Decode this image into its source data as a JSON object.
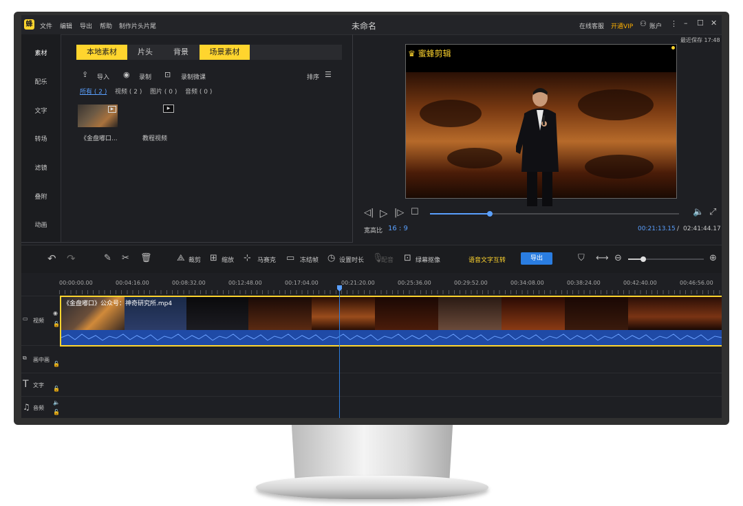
{
  "window": {
    "title": "未命名",
    "menu": [
      "文件",
      "编辑",
      "导出",
      "帮助",
      "制作片头片尾"
    ],
    "right": {
      "support": "在线客服",
      "vip": "开通VIP",
      "account": "账户"
    },
    "last_saved": "最近保存 17:48"
  },
  "sidebar": {
    "items": [
      {
        "label": "素材"
      },
      {
        "label": "配乐"
      },
      {
        "label": "文字"
      },
      {
        "label": "转场"
      },
      {
        "label": "滤镜"
      },
      {
        "label": "叠附"
      },
      {
        "label": "动画"
      }
    ]
  },
  "media": {
    "tabs": [
      {
        "label": "本地素材",
        "active": true
      },
      {
        "label": "片头",
        "active": false
      },
      {
        "label": "背景",
        "active": false
      },
      {
        "label": "场景素材",
        "active": true
      }
    ],
    "toolbar": {
      "import": "导入",
      "record": "录制",
      "record_lesson": "录制微课",
      "sort": "排序"
    },
    "filters": [
      "所有 ( 2 )",
      "视频 ( 2 )",
      "图片 ( 0 )",
      "音频 ( 0 )"
    ],
    "items": [
      {
        "label": "《金盘嘟口..."
      },
      {
        "label": "教程视频"
      }
    ]
  },
  "preview": {
    "watermark": "蜜蜂剪辑",
    "aspect_label": "宽高比",
    "aspect_value": "16 : 9",
    "current_time": "00:21:13.15",
    "separator": "/",
    "total_time": "02:41:44.17",
    "progress": 0.24
  },
  "timeline_toolbar": {
    "crop": "裁剪",
    "zoom": "缩放",
    "mosaic": "马赛克",
    "freeze": "冻结帧",
    "duration": "设置时长",
    "dub": "配音",
    "green": "绿幕抠像",
    "speech": "语音文字互转",
    "export": "导出"
  },
  "ruler": [
    "00:00:00.00",
    "00:04:16.00",
    "00:08:32.00",
    "00:12:48.00",
    "00:17:04.00",
    "00:21:20.00",
    "00:25:36.00",
    "00:29:52.00",
    "00:34:08.00",
    "00:38:24.00",
    "00:42:40.00",
    "00:46:56.00"
  ],
  "tracks": {
    "video": "视频",
    "pip": "画中画",
    "text": "文字",
    "audio": "音频",
    "clip_name": "《金盘嘟口》公众号：神奇研究所.mp4"
  },
  "colors": {
    "accent": "#ffd52e",
    "blue": "#2a7de1",
    "vip": "#ffb000"
  }
}
